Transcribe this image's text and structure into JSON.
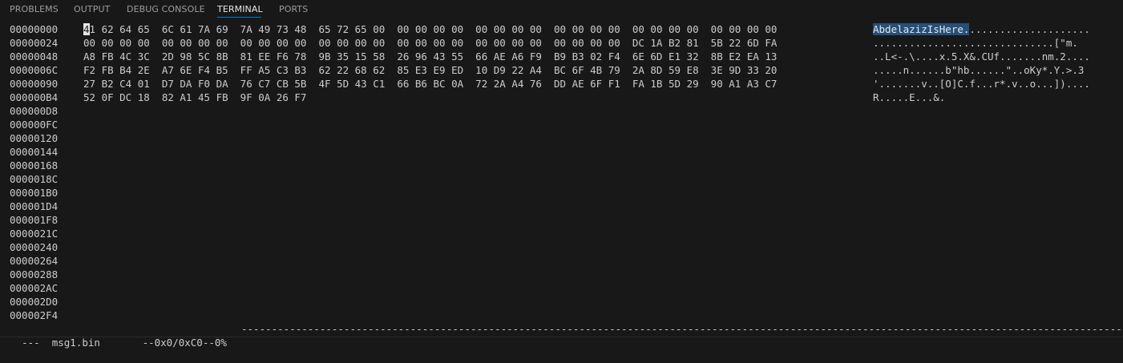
{
  "panel": {
    "tabs": [
      {
        "label": "PROBLEMS"
      },
      {
        "label": "OUTPUT"
      },
      {
        "label": "DEBUG CONSOLE"
      },
      {
        "label": "TERMINAL"
      },
      {
        "label": "PORTS"
      }
    ],
    "active_tab": "TERMINAL"
  },
  "hexdump": {
    "cursor_char": "4",
    "row0_hex_rest": "1 62 64 65  6C 61 7A 69  7A 49 73 48  65 72 65 00  00 00 00 00  00 00 00 00  00 00 00 00  00 00 00 00  00 00 00 00",
    "row0_ascii_selected": "AbdelazizIsHere.",
    "row0_ascii_rest": "....................",
    "rows": [
      {
        "offset": "00000000"
      },
      {
        "offset": "00000024",
        "hex": "00 00 00 00  00 00 00 00  00 00 00 00  00 00 00 00  00 00 00 00  00 00 00 00  00 00 00 00  DC 1A B2 81  5B 22 6D FA",
        "ascii": "..............................[\"m."
      },
      {
        "offset": "00000048",
        "hex": "A8 FB 4C 3C  2D 98 5C 8B  81 EE F6 78  9B 35 15 58  26 96 43 55  66 AE A6 F9  B9 B3 02 F4  6E 6D E1 32  8B E2 EA 13",
        "ascii": "..L<-.\\....x.5.X&.CUf.......nm.2...."
      },
      {
        "offset": "0000006C",
        "hex": "F2 FB B4 2E  A7 6E F4 B5  FF A5 C3 B3  62 22 68 62  85 E3 E9 ED  10 D9 22 A4  BC 6F 4B 79  2A 8D 59 E8  3E 9D 33 20",
        "ascii": ".....n......b\"hb......\"..oKy*.Y.>.3 "
      },
      {
        "offset": "00000090",
        "hex": "27 B2 C4 01  D7 DA F0 DA  76 C7 CB 5B  4F 5D 43 C1  66 B6 BC 0A  72 2A A4 76  DD AE 6F F1  FA 1B 5D 29  90 A1 A3 C7",
        "ascii": "'.......v..[O]C.f...r*.v..o...])...."
      },
      {
        "offset": "000000B4",
        "hex": "52 0F DC 18  82 A1 45 FB  9F 0A 26 F7",
        "ascii": "R.....E...&."
      },
      {
        "offset": "000000D8",
        "hex": "",
        "ascii": ""
      },
      {
        "offset": "000000FC",
        "hex": "",
        "ascii": ""
      },
      {
        "offset": "00000120",
        "hex": "",
        "ascii": ""
      },
      {
        "offset": "00000144",
        "hex": "",
        "ascii": ""
      },
      {
        "offset": "00000168",
        "hex": "",
        "ascii": ""
      },
      {
        "offset": "0000018C",
        "hex": "",
        "ascii": ""
      },
      {
        "offset": "000001B0",
        "hex": "",
        "ascii": ""
      },
      {
        "offset": "000001D4",
        "hex": "",
        "ascii": ""
      },
      {
        "offset": "000001F8",
        "hex": "",
        "ascii": ""
      },
      {
        "offset": "0000021C",
        "hex": "",
        "ascii": ""
      },
      {
        "offset": "00000240",
        "hex": "",
        "ascii": ""
      },
      {
        "offset": "00000264",
        "hex": "",
        "ascii": ""
      },
      {
        "offset": "00000288",
        "hex": "",
        "ascii": ""
      },
      {
        "offset": "000002AC",
        "hex": "",
        "ascii": ""
      },
      {
        "offset": "000002D0",
        "hex": "",
        "ascii": ""
      },
      {
        "offset": "000002F4",
        "hex": "",
        "ascii": ""
      }
    ]
  },
  "status": {
    "prefix": "---  msg1.bin       --0x0/0xC0--0%",
    "dashes": "--------------------------------------------------------------------------------------------------------------------------------------------------------------------------------"
  },
  "colors": {
    "background": "#181818",
    "text": "#cccccc",
    "selection": "#264f78",
    "tab_accent": "#0078d4"
  }
}
